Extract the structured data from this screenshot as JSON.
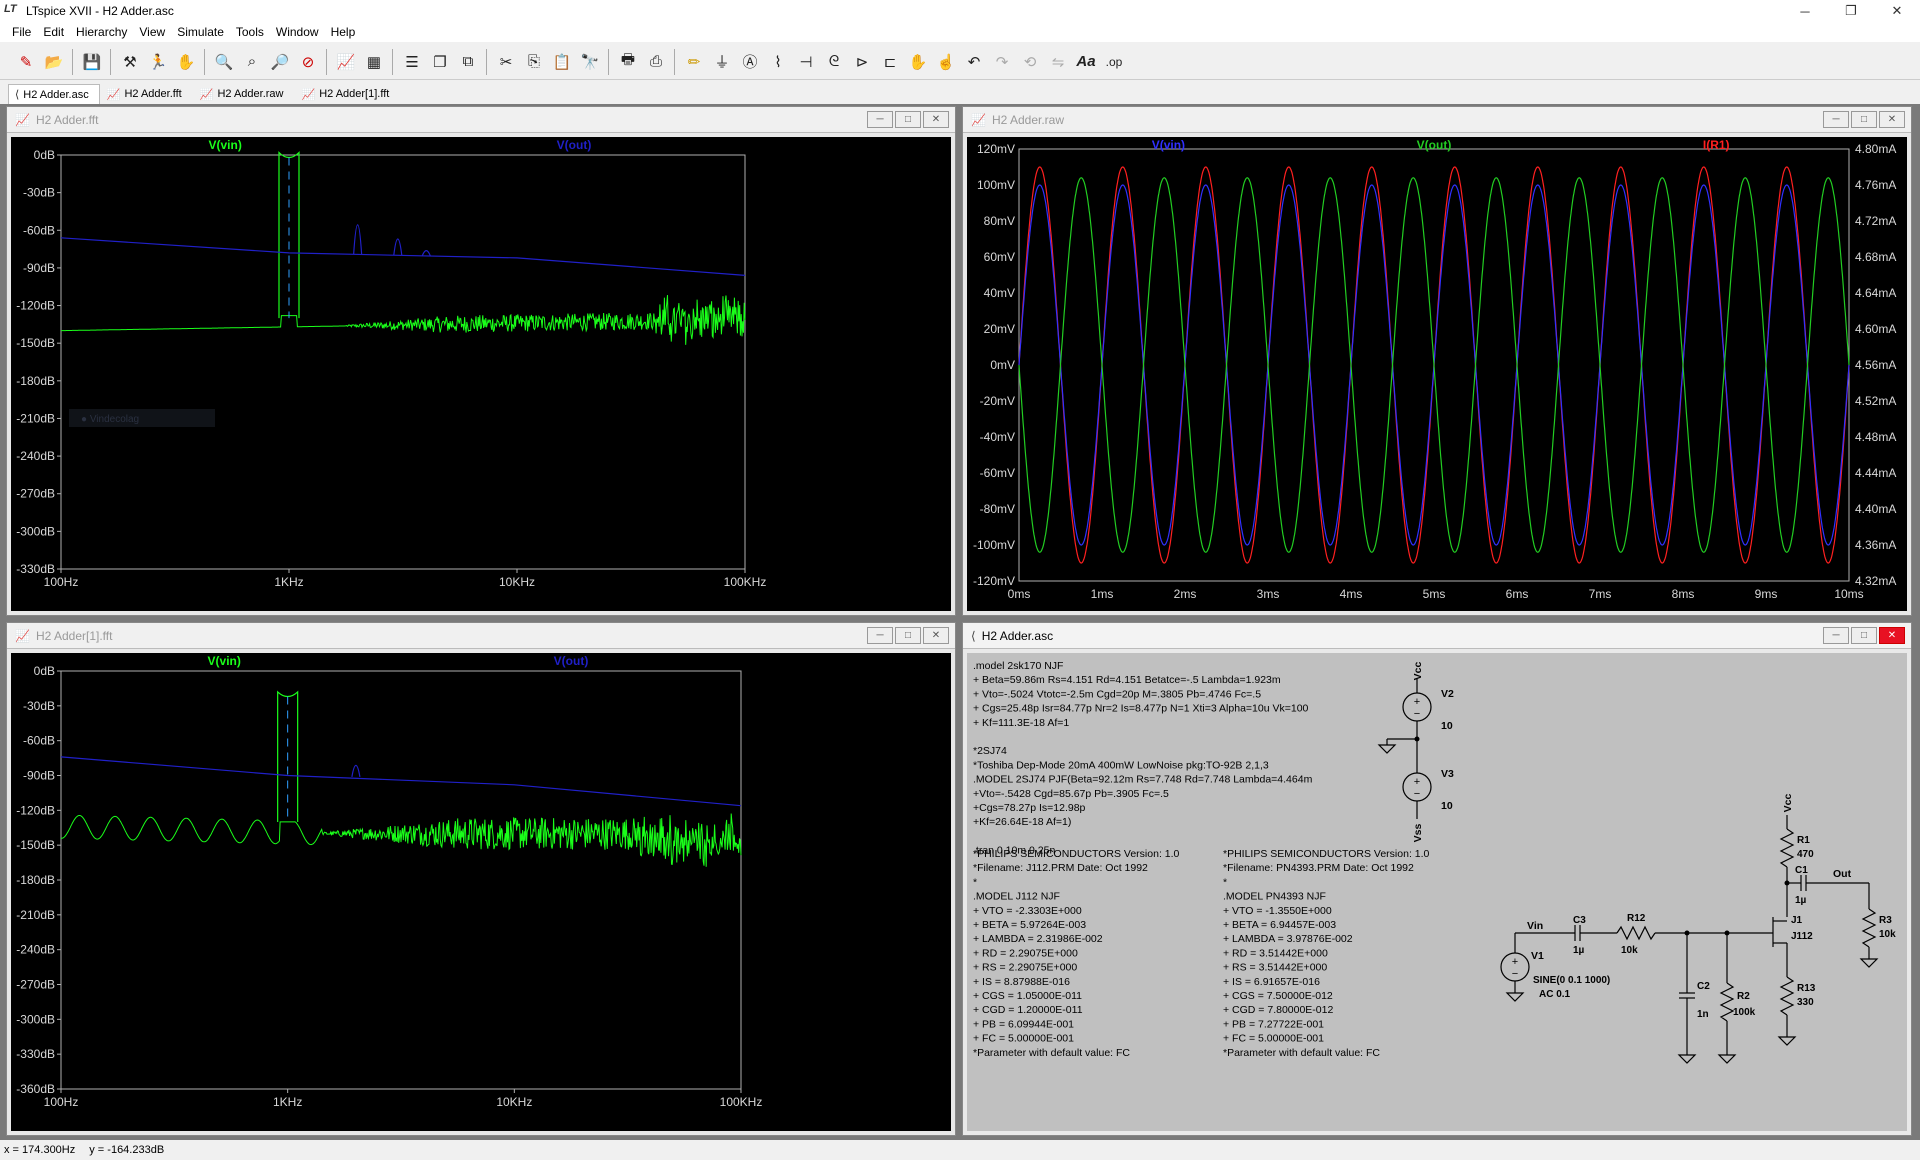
{
  "app": {
    "title": "LTspice XVII - H2 Adder.asc"
  },
  "menu": [
    "File",
    "Edit",
    "Hierarchy",
    "View",
    "Simulate",
    "Tools",
    "Window",
    "Help"
  ],
  "toolbar_icons": [
    "new-schematic-icon",
    "open-icon",
    "save-icon",
    "control-panel-icon",
    "run-icon",
    "halt-icon",
    "zoom-in-icon",
    "zoom-pan-icon",
    "zoom-out-icon",
    "zoom-fit-icon",
    "autorange-icon",
    "view-grid-icon",
    "tile-icon",
    "cascade-icon",
    "close-all-icon",
    "cut-icon",
    "copy-icon",
    "paste-icon",
    "find-icon",
    "print-icon",
    "print-setup-icon",
    "draw-wire-icon",
    "ground-icon",
    "label-net-icon",
    "resistor-icon",
    "capacitor-icon",
    "inductor-icon",
    "diode-icon",
    "component-icon",
    "move-icon",
    "drag-icon",
    "undo-icon",
    "redo-icon",
    "rotate-icon",
    "mirror-icon",
    "text-icon",
    "spice-directive-icon"
  ],
  "tabs": [
    {
      "label": "H2 Adder.asc",
      "active": true
    },
    {
      "label": "H2 Adder.fft",
      "active": false
    },
    {
      "label": "H2 Adder.raw",
      "active": false
    },
    {
      "label": "H2 Adder[1].fft",
      "active": false
    }
  ],
  "windows": {
    "fft1": {
      "title": "H2 Adder.fft",
      "trace1": "V(vin)",
      "trace2": "V(out)",
      "tooltip": "Vindecolag"
    },
    "raw": {
      "title": "H2 Adder.raw",
      "trace1": "V(vin)",
      "trace2": "V(out)",
      "trace3": "I(R1)"
    },
    "fft2": {
      "title": "H2 Adder[1].fft",
      "trace1": "V(vin)",
      "trace2": "V(out)"
    },
    "sch": {
      "title": "H2 Adder.asc"
    }
  },
  "colors": {
    "vin_fft": "#1aff1a",
    "out_fft": "#2020c8",
    "vin_raw": "#3030ff",
    "out_raw": "#22cc22",
    "ir1": "#ff2020"
  },
  "chart_data": [
    {
      "type": "line",
      "title": "H2 Adder.fft",
      "x_scale": "log",
      "xlim": [
        100,
        100000
      ],
      "ylim": [
        -330,
        0
      ],
      "x_ticks": [
        "100Hz",
        "1KHz",
        "10KHz",
        "100KHz"
      ],
      "y_ticks": [
        "0dB",
        "-30dB",
        "-60dB",
        "-90dB",
        "-120dB",
        "-150dB",
        "-180dB",
        "-210dB",
        "-240dB",
        "-270dB",
        "-300dB",
        "-330dB"
      ],
      "series": [
        {
          "name": "V(vin)",
          "color": "#1aff1a",
          "description": "baseline ~-138 to -150dB, fundamental peak 0dB at 1KHz, noise rising near 40-100KHz"
        },
        {
          "name": "V(out)",
          "color": "#2020c8",
          "points": [
            [
              100,
              -66
            ],
            [
              1000,
              -78
            ],
            [
              10000,
              -82
            ],
            [
              100000,
              -96
            ]
          ],
          "harmonics": [
            [
              2000,
              -40
            ],
            [
              3000,
              -62
            ],
            [
              4000,
              -80
            ]
          ]
        }
      ]
    },
    {
      "type": "line",
      "title": "H2 Adder.raw",
      "xlim": [
        0,
        10
      ],
      "ylim": [
        -120,
        120
      ],
      "x_ticks": [
        "0ms",
        "1ms",
        "2ms",
        "3ms",
        "4ms",
        "5ms",
        "6ms",
        "7ms",
        "8ms",
        "9ms",
        "10ms"
      ],
      "y_ticks": [
        "120mV",
        "100mV",
        "80mV",
        "60mV",
        "40mV",
        "20mV",
        "0mV",
        "-20mV",
        "-40mV",
        "-60mV",
        "-80mV",
        "-100mV",
        "-120mV"
      ],
      "y2_ticks": [
        "4.80mA",
        "4.76mA",
        "4.72mA",
        "4.68mA",
        "4.64mA",
        "4.60mA",
        "4.56mA",
        "4.52mA",
        "4.48mA",
        "4.44mA",
        "4.40mA",
        "4.36mA",
        "4.32mA"
      ],
      "series": [
        {
          "name": "V(vin)",
          "color": "#3030ff",
          "amplitude_mV": 100,
          "freq_hz": 1000,
          "phase_deg": 0
        },
        {
          "name": "V(out)",
          "color": "#22cc22",
          "amplitude_mV": 104,
          "freq_hz": 1000,
          "phase_deg": 180
        },
        {
          "name": "I(R1)",
          "color": "#ff2020",
          "amplitude_mV": 110,
          "freq_hz": 1000,
          "phase_deg": 0
        }
      ]
    },
    {
      "type": "line",
      "title": "H2 Adder[1].fft",
      "x_scale": "log",
      "xlim": [
        100,
        100000
      ],
      "ylim": [
        -360,
        0
      ],
      "x_ticks": [
        "100Hz",
        "1KHz",
        "10KHz",
        "100KHz"
      ],
      "y_ticks": [
        "0dB",
        "-30dB",
        "-60dB",
        "-90dB",
        "-120dB",
        "-150dB",
        "-180dB",
        "-210dB",
        "-240dB",
        "-270dB",
        "-300dB",
        "-330dB",
        "-360dB"
      ],
      "series": [
        {
          "name": "V(vin)",
          "color": "#1aff1a",
          "description": "baseline ~-130 to -150dB, fundamental peak at 1KHz near -20dB"
        },
        {
          "name": "V(out)",
          "color": "#2020c8",
          "points": [
            [
              100,
              -74
            ],
            [
              1000,
              -90
            ],
            [
              10000,
              -98
            ],
            [
              100000,
              -116
            ]
          ],
          "harmonics": [
            [
              2000,
              -80
            ]
          ]
        }
      ]
    }
  ],
  "schematic": {
    "directives": [
      ".model 2sk170 NJF",
      "+ Beta=59.86m Rs=4.151 Rd=4.151 Betatce=-.5 Lambda=1.923m",
      "+ Vto=-.5024 Vtotc=-2.5m Cgd=20p M=.3805 Pb=.4746 Fc=.5",
      "+ Cgs=25.48p Isr=84.77p Nr=2 Is=8.477p N=1 Xti=3 Alpha=10u Vk=100",
      "+ Kf=111.3E-18 Af=1",
      "",
      "*2SJ74",
      "*Toshiba Dep-Mode 20mA 400mW LowNoise pkg:TO-92B 2,1,3",
      ".MODEL 2SJ74 PJF(Beta=92.12m Rs=7.748 Rd=7.748 Lambda=4.464m",
      "+Vto=-.5428 Cgd=85.67p Pb=.3905 Fc=.5",
      "+Cgs=78.27p Is=12.98p",
      "+Kf=26.64E-18 Af=1)",
      "",
      ".tran 0 10m 0 25n"
    ],
    "model1": [
      "*PHILIPS SEMICONDUCTORS        Version: 1.0",
      "*Filename:  J112.PRM        Date: Oct 1992",
      "*",
      ".MODEL  J112   NJF",
      "+           VTO = -2.3303E+000",
      "+           BETA = 5.97264E-003",
      "+       LAMBDA = 2.31986E-002",
      "+             RD = 2.29075E+000",
      "+             RS = 2.29075E+000",
      "+               IS = 8.87988E-016",
      "+           CGS = 1.05000E-011",
      "+           CGD = 1.20000E-011",
      "+             PB = 6.09944E-001",
      "+             FC = 5.00000E-001",
      "*Parameter with default value: FC"
    ],
    "model2": [
      "*PHILIPS SEMICONDUCTORS        Version: 1.0",
      "*Filename: PN4393.PRM       Date: Oct 1992",
      "*",
      ".MODEL  PN4393   NJF",
      "+           VTO = -1.3550E+000",
      "+           BETA = 6.94457E-003",
      "+       LAMBDA = 3.97876E-002",
      "+             RD = 3.51442E+000",
      "+             RS = 3.51442E+000",
      "+               IS = 6.91657E-016",
      "+           CGS = 7.50000E-012",
      "+           CGD = 7.80000E-012",
      "+             PB = 7.27722E-001",
      "+             FC = 5.00000E-001",
      "*Parameter with default value: FC"
    ],
    "labels": {
      "vcc1": "Vcc",
      "v2": "V2",
      "v2val": "10",
      "v3": "V3",
      "v3val": "10",
      "vss": "Vss",
      "vcc2": "Vcc",
      "r1": "R1",
      "r1val": "470",
      "c1": "C1",
      "c1val": "1µ",
      "out": "Out",
      "j1": "J1",
      "j1val": "J112",
      "r3": "R3",
      "r3val": "10k",
      "vin": "Vin",
      "c3": "C3",
      "c3val": "1µ",
      "r12": "R12",
      "r12val": "10k",
      "v1": "V1",
      "v1val1": "SINE(0 0.1 1000)",
      "v1val2": "AC 0.1",
      "c2": "C2",
      "c2val": "1n",
      "r2": "R2",
      "r2val": "100k",
      "r13": "R13",
      "r13val": "330"
    }
  },
  "status": {
    "x": "x = 174.300Hz",
    "y": "y = -164.233dB"
  }
}
